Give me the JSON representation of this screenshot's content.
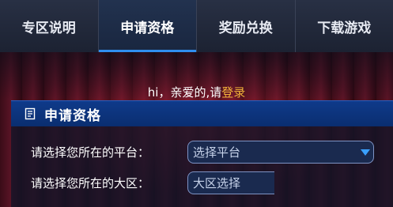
{
  "nav": {
    "tabs": [
      {
        "label": "专区说明"
      },
      {
        "label": "申请资格"
      },
      {
        "label": "奖励兑换"
      },
      {
        "label": "下载游戏"
      }
    ]
  },
  "greeting": {
    "text": "hi，亲爱的,请",
    "login_link": "登录"
  },
  "panel": {
    "title": "申请资格",
    "icon": "document-icon",
    "rows": [
      {
        "label": "请选择您所在的平台：",
        "select_value": "选择平台"
      },
      {
        "label": "请选择您所在的大区：",
        "select_value": "大区选择"
      }
    ]
  },
  "colors": {
    "accent": "#2f8ff0",
    "link": "#f3b43a",
    "panel_header": "#0f3a8a"
  }
}
